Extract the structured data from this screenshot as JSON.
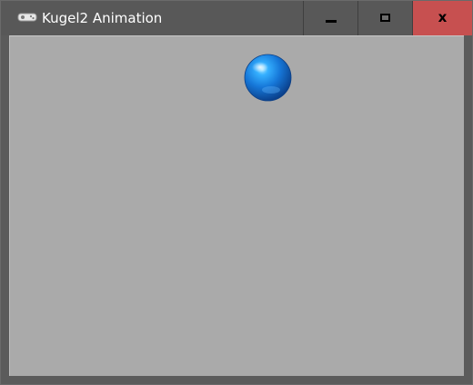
{
  "window": {
    "title": "Kugel2 Animation",
    "app_icon": "controller-icon"
  },
  "controls": {
    "minimize": "minimize-icon",
    "maximize": "maximize-icon",
    "close_label": "x",
    "close_color": "#c75050"
  },
  "canvas": {
    "background": "#aaaaaa",
    "ball_color": "#1a7fe0",
    "ball_icon": "sphere"
  }
}
